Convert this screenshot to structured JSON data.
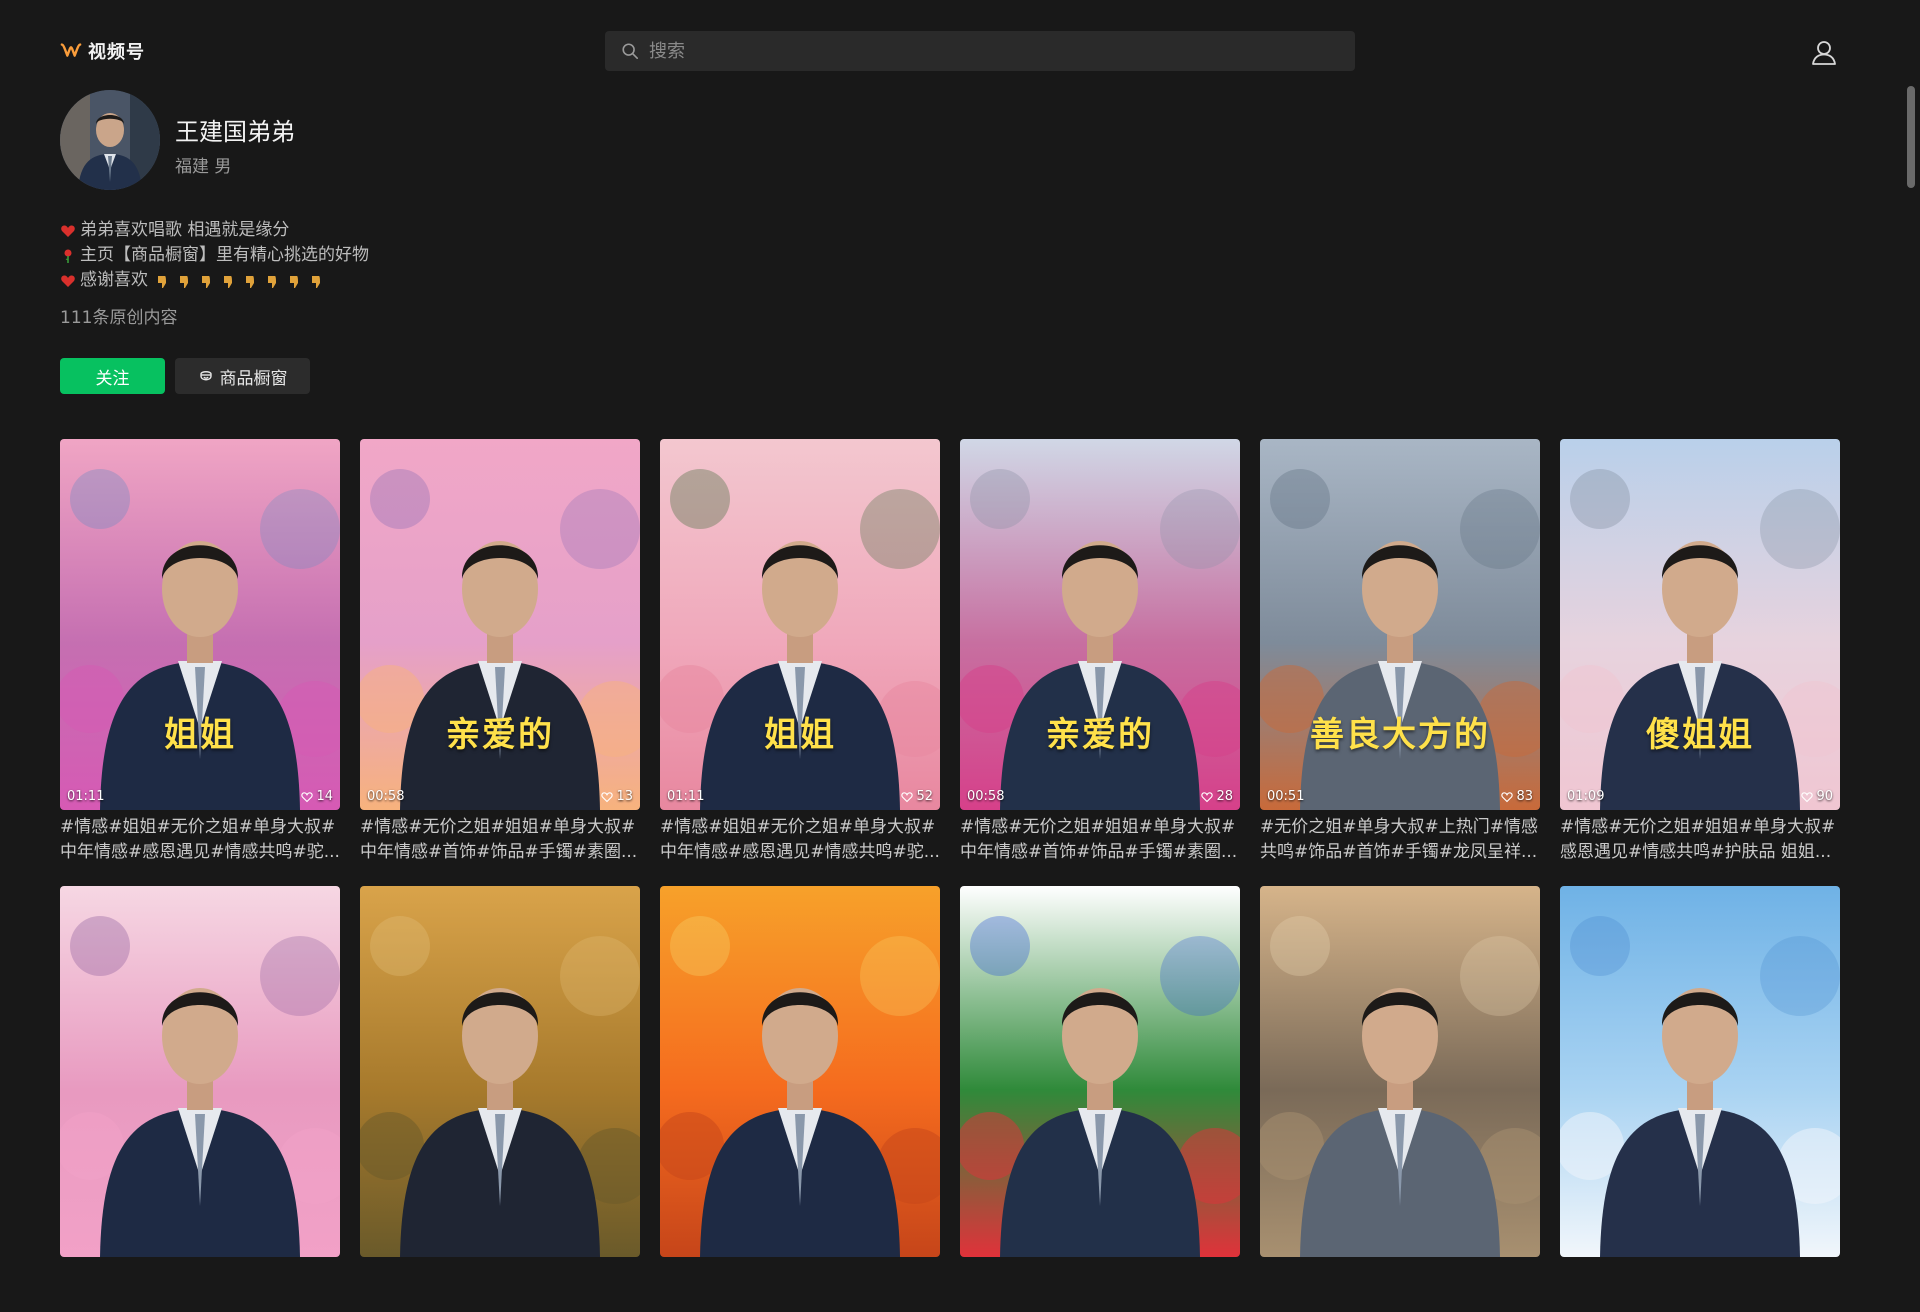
{
  "header": {
    "logo_text": "视频号",
    "brand_color": "#fa9d3b",
    "search_placeholder": "搜索"
  },
  "profile": {
    "name": "王建国弟弟",
    "location_gender": "福建 男",
    "bio": [
      {
        "icon": "heart-icon",
        "text": "弟弟喜欢唱歌 相遇就是缘分"
      },
      {
        "icon": "rose-icon",
        "text": "主页【商品橱窗】里有精心挑选的好物"
      },
      {
        "icon": "heart-icon",
        "text": "感谢喜欢"
      }
    ],
    "original_count": "111条原创内容"
  },
  "actions": {
    "follow_label": "关注",
    "follow_color": "#07c160",
    "shop_label": "商品橱窗"
  },
  "videos": [
    {
      "overlay": "姐姐",
      "duration": "01:11",
      "likes": "14",
      "caption": "#情感#姐姐#无价之姐#单身大叔#中年情感#感恩遇见#情感共鸣#驼..."
    },
    {
      "overlay": "亲爱的",
      "duration": "00:58",
      "likes": "13",
      "caption": "#情感#无价之姐#姐姐#单身大叔#中年情感#首饰#饰品#手镯#素圈..."
    },
    {
      "overlay": "姐姐",
      "duration": "01:11",
      "likes": "52",
      "caption": "#情感#姐姐#无价之姐#单身大叔#中年情感#感恩遇见#情感共鸣#驼..."
    },
    {
      "overlay": "亲爱的",
      "duration": "00:58",
      "likes": "28",
      "caption": "#情感#无价之姐#姐姐#单身大叔#中年情感#首饰#饰品#手镯#素圈..."
    },
    {
      "overlay": "善良大方的",
      "duration": "00:51",
      "likes": "83",
      "caption": "#无价之姐#单身大叔#上热门#情感共鸣#饰品#首饰#手镯#龙凤呈祥..."
    },
    {
      "overlay": "傻姐姐",
      "duration": "01:09",
      "likes": "90",
      "caption": "#情感#无价之姐#姐姐#单身大叔#感恩遇见#情感共鸣#护肤品 姐姐..."
    },
    {
      "overlay": "",
      "duration": "",
      "likes": "",
      "caption": ""
    },
    {
      "overlay": "",
      "duration": "",
      "likes": "",
      "caption": ""
    },
    {
      "overlay": "",
      "duration": "",
      "likes": "",
      "caption": ""
    },
    {
      "overlay": "",
      "duration": "",
      "likes": "",
      "caption": ""
    },
    {
      "overlay": "",
      "duration": "",
      "likes": "",
      "caption": ""
    },
    {
      "overlay": "",
      "duration": "",
      "likes": "",
      "caption": ""
    }
  ]
}
